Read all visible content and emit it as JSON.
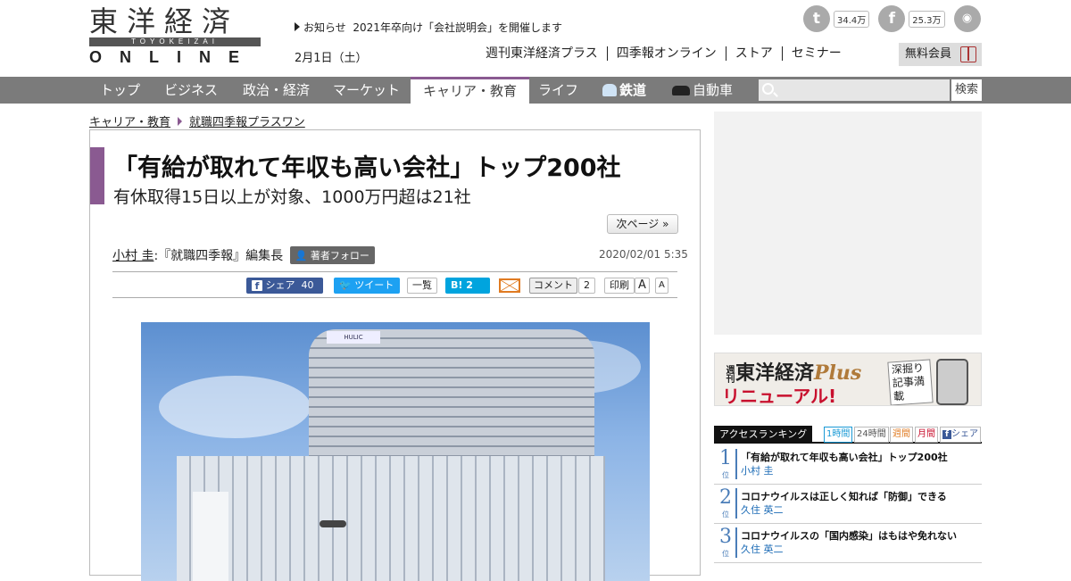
{
  "header": {
    "logo_jp": "東洋経済",
    "logo_roman": "TOYOKEIZAI",
    "logo_online": "ONLINE",
    "news_label": "お知らせ",
    "news_text": "2021年卒向け「会社説明会」を開催します",
    "date": "2月1日（土）",
    "links": [
      "週刊東洋経済プラス",
      "四季報オンライン",
      "ストア",
      "セミナー"
    ],
    "member_label": "無料会員",
    "social": {
      "twitter_count": "34.4万",
      "facebook_count": "25.3万"
    }
  },
  "nav": {
    "items": [
      "トップ",
      "ビジネス",
      "政治・経済",
      "マーケット",
      "キャリア・教育",
      "ライフ",
      "鉄道",
      "自動車"
    ],
    "active": "キャリア・教育",
    "search_button": "検索",
    "search_placeholder": ""
  },
  "breadcrumb": [
    "キャリア・教育",
    "就職四季報プラスワン"
  ],
  "article": {
    "title": "「有給が取れて年収も高い会社」トップ200社",
    "subtitle": "有休取得15日以上が対象、1000万円超は21社",
    "next_page": "次ページ »",
    "author_name": "小村 圭",
    "author_role": ":『就職四季報』編集長",
    "follow_label": "著者フォロー",
    "published": "2020/02/01 5:35",
    "share": {
      "fb_label": "シェア",
      "fb_count": "40",
      "tw_label": "ツイート",
      "list_label": "一覧",
      "hatena_label": "B!",
      "hatena_count": "2",
      "comment_label": "コメント",
      "comment_count": "2",
      "print_label": "印刷",
      "font_large": "A",
      "font_small": "A"
    },
    "photo_sign": "HULIC"
  },
  "sidebar": {
    "plus": {
      "brand_prefix": "週刊",
      "brand_name": "東洋経済",
      "brand_plus": "Plus",
      "renewal": "リニューアル!",
      "deep": "深掘り記事満載"
    },
    "ranking": {
      "title": "アクセスランキング",
      "tabs": [
        "1時間",
        "24時間",
        "週間",
        "月間",
        "シェア"
      ],
      "unit": "位",
      "items": [
        {
          "rank": "1",
          "title": "「有給が取れて年収も高い会社」トップ200社",
          "author": "小村 圭"
        },
        {
          "rank": "2",
          "title": "コロナウイルスは正しく知れば「防御」できる",
          "author": "久住 英二"
        },
        {
          "rank": "3",
          "title": "コロナウイルスの「国内感染」はもはや免れない",
          "author": "久住 英二"
        }
      ]
    }
  },
  "colors": {
    "accent": "#8a5a91",
    "nav_bg": "#7b7b7b",
    "facebook": "#3b5998",
    "twitter": "#1da1f2",
    "hatena": "#00a4de",
    "rank_blue": "#4a7db8"
  }
}
